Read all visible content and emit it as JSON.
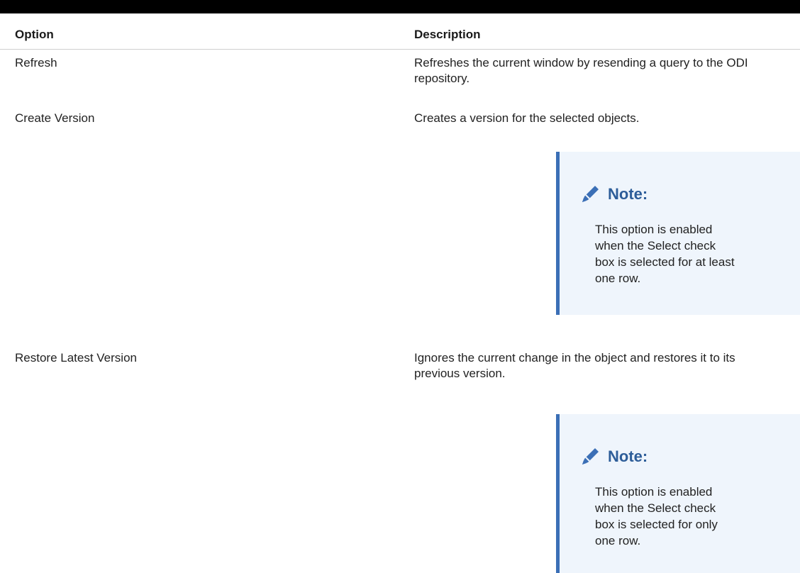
{
  "table": {
    "headers": {
      "option": "Option",
      "description": "Description"
    },
    "rows": [
      {
        "option": "Refresh",
        "description": "Refreshes the current window by resending a query to the ODI repository."
      },
      {
        "option": "Create Version",
        "description": "Creates a version for the selected objects.",
        "note": {
          "title": "Note:",
          "body": "This option is enabled when the Select check box is selected for at least one row."
        }
      },
      {
        "option": "Restore Latest Version",
        "description": "Ignores the current change in the object and restores it to its previous version.",
        "note": {
          "title": "Note:",
          "body": "This option is enabled when the Select check box is selected for only one row."
        }
      }
    ]
  },
  "icons": {
    "note": "pencil-icon"
  },
  "colors": {
    "note_accent": "#3b6fb6",
    "note_background": "#eff5fc",
    "note_title": "#2d5d99",
    "top_rule": "#000000"
  }
}
